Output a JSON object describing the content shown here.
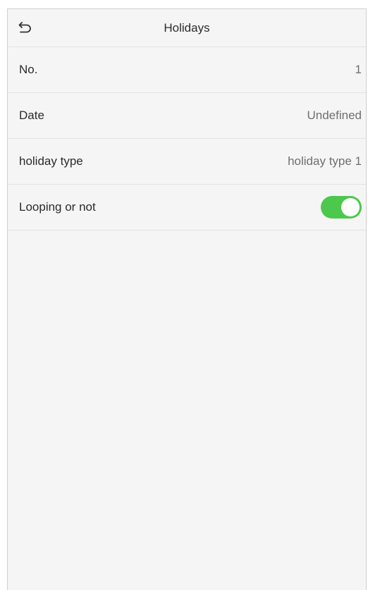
{
  "header": {
    "title": "Holidays",
    "back_icon": "back-arrow-icon"
  },
  "rows": [
    {
      "label": "No.",
      "value": "1"
    },
    {
      "label": "Date",
      "value": "Undefined"
    },
    {
      "label": "holiday type",
      "value": "holiday type 1"
    },
    {
      "label": "Looping or not",
      "toggle_on": true
    }
  ],
  "colors": {
    "toggle_on": "#4cc84c",
    "background": "#f5f5f5",
    "divider": "#e2e2e2"
  }
}
